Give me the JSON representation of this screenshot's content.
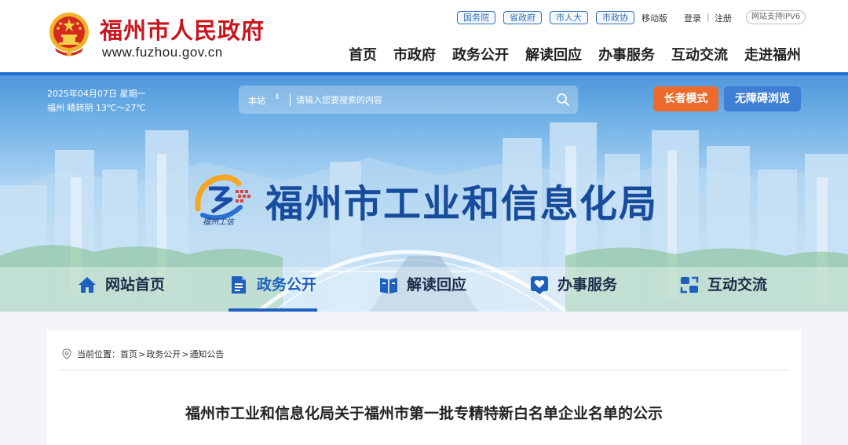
{
  "header": {
    "title": "福州市人民政府",
    "url": "www.fuzhou.gov.cn",
    "gov_links": [
      "国务院",
      "省政府",
      "市人大",
      "市政协"
    ],
    "mobile": "移动版",
    "login": "登录",
    "separator": "|",
    "register": "注册",
    "ipv6": "网站支持IPV6",
    "nav": [
      "首页",
      "市政府",
      "政务公开",
      "解读回应",
      "办事服务",
      "互动交流",
      "走进福州"
    ]
  },
  "banner": {
    "date": "2025年04月07日 星期一",
    "weather": "福州 晴转阴 13℃～27℃",
    "search": {
      "scope": "本站",
      "caret": "⇕",
      "placeholder": "请输入您要搜索的内容"
    },
    "elder_mode": "长者模式",
    "accessible": "无障碍浏览",
    "logo_caption": "福州工信",
    "bureau_title": "福州市工业和信息化局",
    "sub_nav": [
      {
        "label": "网站首页",
        "icon": "home-icon"
      },
      {
        "label": "政务公开",
        "icon": "document-icon"
      },
      {
        "label": "解读回应",
        "icon": "book-icon"
      },
      {
        "label": "办事服务",
        "icon": "heart-service-icon"
      },
      {
        "label": "互动交流",
        "icon": "exchange-icon"
      }
    ],
    "active_sub_nav": "政务公开"
  },
  "content": {
    "breadcrumb": {
      "prefix": "当前位置：",
      "items": [
        "首页",
        "政务公开",
        "通知公告"
      ],
      "sep": ">"
    },
    "article_title": "福州市工业和信息化局关于福州市第一批专精特新白名单企业名单的公示"
  },
  "colors": {
    "brand_red": "#c8161d",
    "brand_blue": "#1f5fbf",
    "elder_orange": "#ec6a2c",
    "accessible_blue": "#3f7fd6"
  }
}
